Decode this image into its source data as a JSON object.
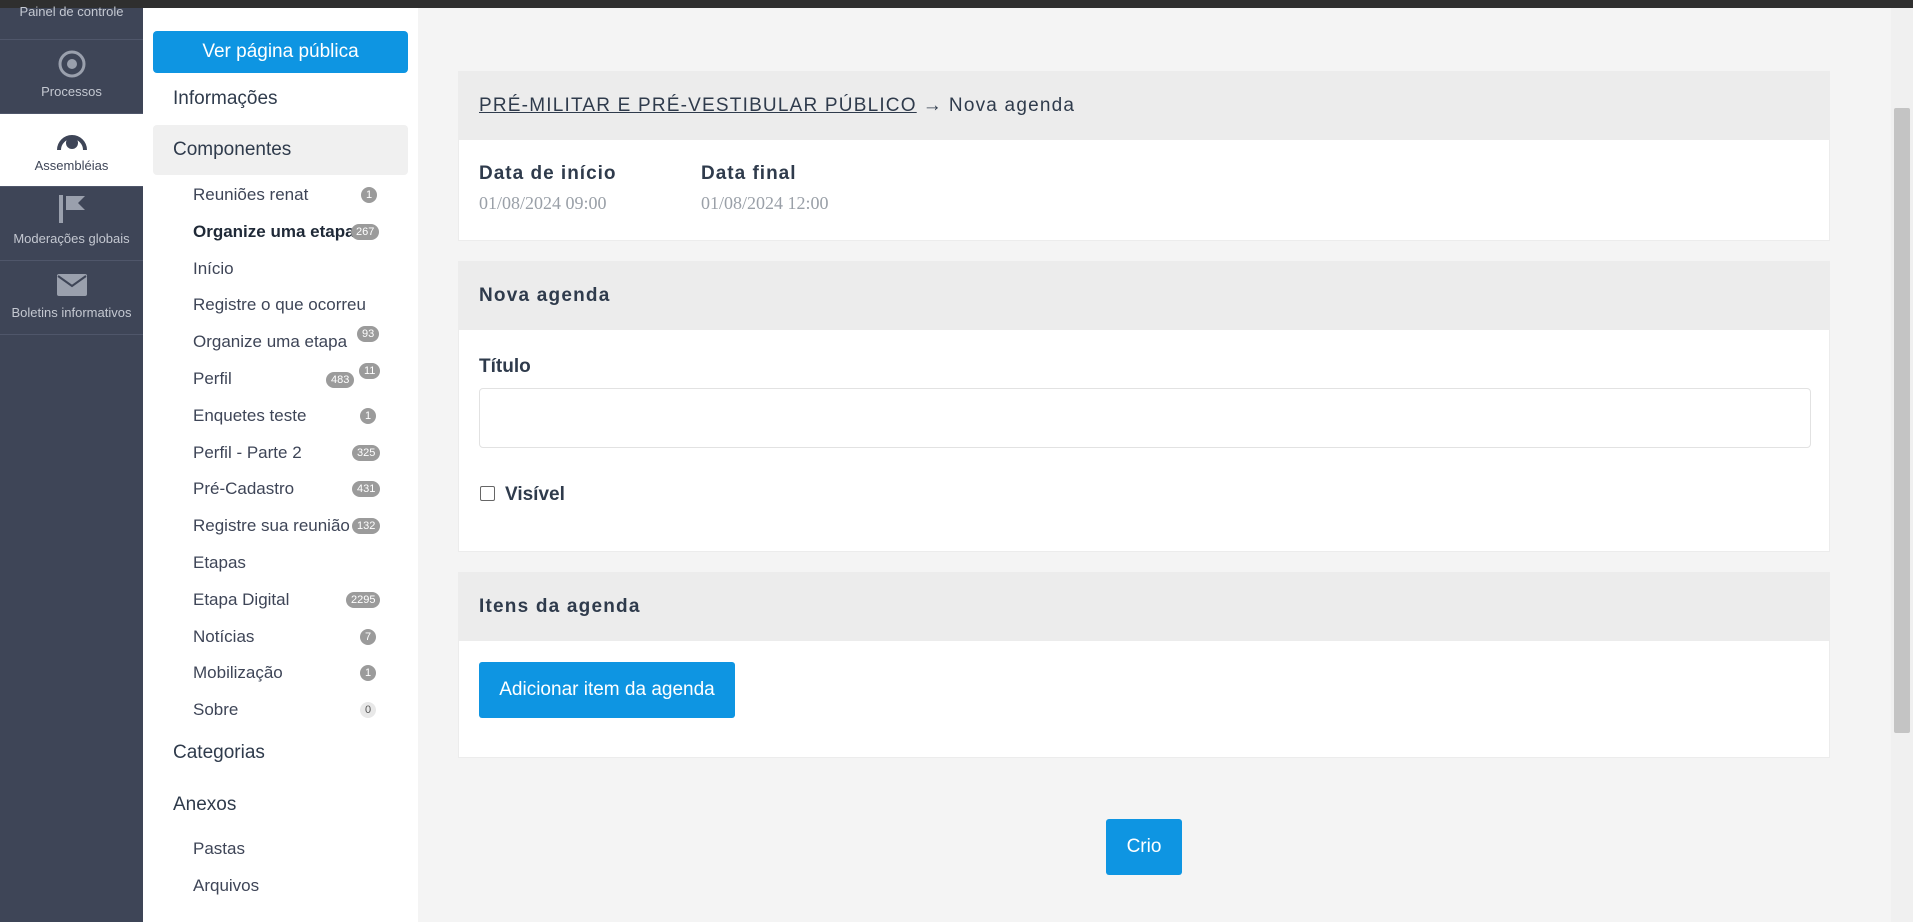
{
  "rail": {
    "items": [
      {
        "label": "Painel de controle",
        "icon": "dashboard-icon"
      },
      {
        "label": "Processos",
        "icon": "target-icon"
      },
      {
        "label": "Assembléias",
        "icon": "assembly-icon"
      },
      {
        "label": "Moderações globais",
        "icon": "flag-icon"
      },
      {
        "label": "Boletins informativos",
        "icon": "envelope-icon"
      }
    ]
  },
  "subnav": {
    "public_button": "Ver página pública",
    "informacoes": "Informações",
    "componentes": "Componentes",
    "components": [
      {
        "label": "Reuniões renat",
        "badge": "1"
      },
      {
        "label": "Organize uma etapa",
        "badge": "267"
      },
      {
        "label": "Início",
        "badge": ""
      },
      {
        "label": "Registre o que ocorreu",
        "badge": ""
      },
      {
        "label": "Organize uma etapa",
        "badge": "93"
      },
      {
        "label": "Perfil",
        "badge": "483",
        "badge2": "11"
      },
      {
        "label": "Enquetes teste",
        "badge": "1"
      },
      {
        "label": "Perfil - Parte 2",
        "badge": "325"
      },
      {
        "label": "Pré-Cadastro",
        "badge": "431"
      },
      {
        "label": "Registre sua reunião",
        "badge": "132"
      },
      {
        "label": "Etapas",
        "badge": ""
      },
      {
        "label": "Etapa Digital",
        "badge": "2295"
      },
      {
        "label": "Notícias",
        "badge": "7"
      },
      {
        "label": "Mobilização",
        "badge": "1"
      },
      {
        "label": "Sobre",
        "badge": "0"
      }
    ],
    "categorias": "Categorias",
    "anexos": "Anexos",
    "pastas": "Pastas",
    "arquivos": "Arquivos"
  },
  "main": {
    "breadcrumb_link": "PRÉ-MILITAR E PRÉ-VESTIBULAR PÚBLICO",
    "breadcrumb_arrow": "→",
    "breadcrumb_current": "Nova agenda",
    "start_label": "Data de início",
    "start_value": "01/08/2024 09:00",
    "end_label": "Data final",
    "end_value": "01/08/2024 12:00",
    "form_title": "Nova agenda",
    "title_label": "Título",
    "title_value": "",
    "visible_label": "Visível",
    "visible_checked": false,
    "items_title": "Itens da agenda",
    "add_item_button": "Adicionar item da agenda",
    "create_button": "Crio"
  },
  "colors": {
    "accent": "#0e95e2",
    "rail_bg": "#3e4557",
    "card_header_bg": "#ececec"
  }
}
